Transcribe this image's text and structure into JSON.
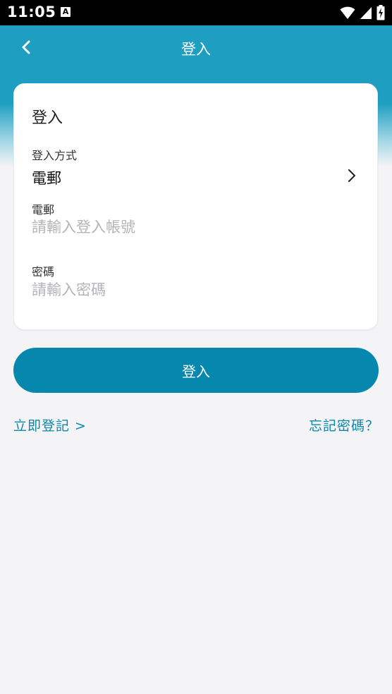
{
  "status_bar": {
    "time": "11:05",
    "app_badge": "A"
  },
  "header": {
    "title": "登入"
  },
  "card": {
    "title": "登入",
    "method_label": "登入方式",
    "method_value": "電郵",
    "email_label": "電郵",
    "email_placeholder": "請輸入登入帳號",
    "password_label": "密碼",
    "password_placeholder": "請輸入密碼"
  },
  "actions": {
    "login_label": "登入",
    "register_label": "立即登記 >",
    "forgot_label": "忘記密碼？"
  },
  "colors": {
    "header": "#1e9ec0",
    "primary_button": "#0688ae",
    "link": "#0a87ad",
    "background": "#f4f4f7"
  }
}
